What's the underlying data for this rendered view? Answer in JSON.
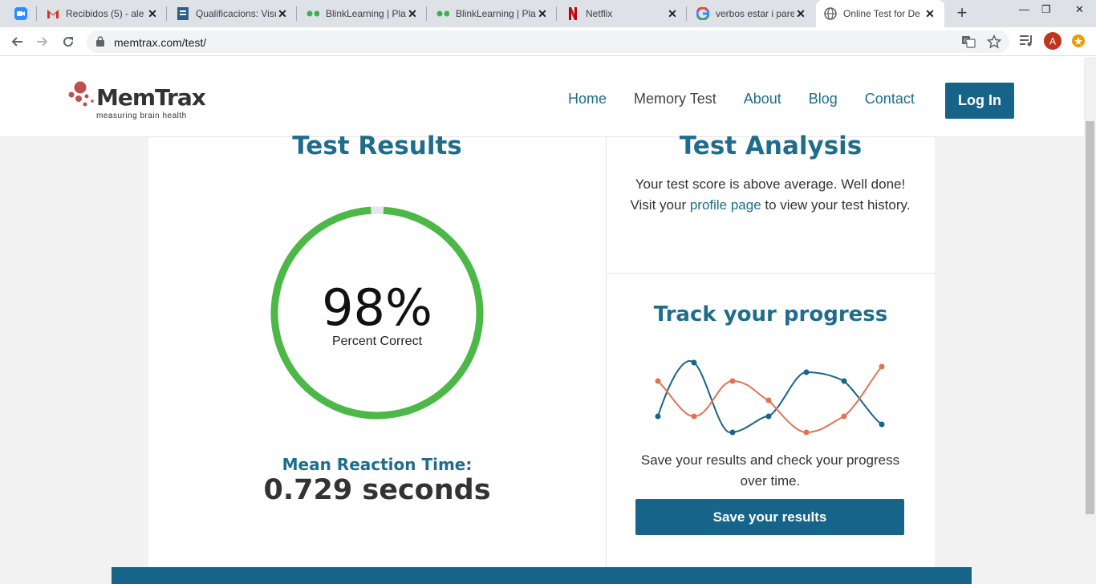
{
  "browser": {
    "tabs": [
      {
        "title": "",
        "icon": "zoom-icon"
      },
      {
        "title": "Recibidos (5) - ale",
        "icon": "gmail-icon"
      },
      {
        "title": "Qualificacions: Visu",
        "icon": "document-icon"
      },
      {
        "title": "BlinkLearning | Pla",
        "icon": "blinklearning-icon"
      },
      {
        "title": "BlinkLearning | Pla",
        "icon": "blinklearning-icon"
      },
      {
        "title": "Netflix",
        "icon": "netflix-icon"
      },
      {
        "title": "verbos estar i pare",
        "icon": "google-icon"
      },
      {
        "title": "Online Test for De",
        "icon": "globe-icon"
      }
    ],
    "url": "memtrax.com/test/",
    "profile_initial": "A"
  },
  "site": {
    "logo_word": "MemTrax",
    "logo_tagline": "measuring brain health",
    "nav": [
      "Home",
      "Memory Test",
      "About",
      "Blog",
      "Contact"
    ],
    "login_label": "Log In"
  },
  "results": {
    "title": "Test Results",
    "percent": "98%",
    "percent_value": 0.98,
    "percent_label": "Percent Correct",
    "mrt_label": "Mean Reaction Time:",
    "mrt_value": "0.729 seconds"
  },
  "analysis": {
    "title": "Test Analysis",
    "line1": "Your test score is above average. Well done!",
    "line2_pre": "Visit your ",
    "line2_link": "profile page",
    "line2_post": " to view your test history."
  },
  "track": {
    "title": "Track your progress",
    "text": "Save your results and check your progress over time.",
    "button": "Save your results"
  },
  "colors": {
    "brand": "#16648a",
    "ring": "#4cb847",
    "ring_track": "#e6e6e6",
    "wave_blue": "#1a6489",
    "wave_orange": "#e07353"
  }
}
